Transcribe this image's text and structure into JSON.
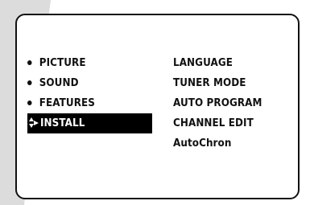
{
  "main_menu": {
    "items": [
      {
        "label": "PICTURE",
        "selected": false
      },
      {
        "label": "SOUND",
        "selected": false
      },
      {
        "label": "FEATURES",
        "selected": false
      },
      {
        "label": "INSTALL",
        "selected": true
      }
    ]
  },
  "submenu": {
    "items": [
      {
        "label": "LANGUAGE"
      },
      {
        "label": "TUNER MODE"
      },
      {
        "label": "AUTO PROGRAM"
      },
      {
        "label": "CHANNEL EDIT"
      },
      {
        "label": "AutoChron"
      }
    ]
  },
  "colors": {
    "background": "#ffffff",
    "backdrop_shape": "#dcdcdc",
    "text": "#111111",
    "highlight_bg": "#000000",
    "highlight_text": "#ffffff"
  },
  "icons": {
    "selector": "up-down-right-arrow-icon",
    "bullet": "bullet-icon"
  }
}
